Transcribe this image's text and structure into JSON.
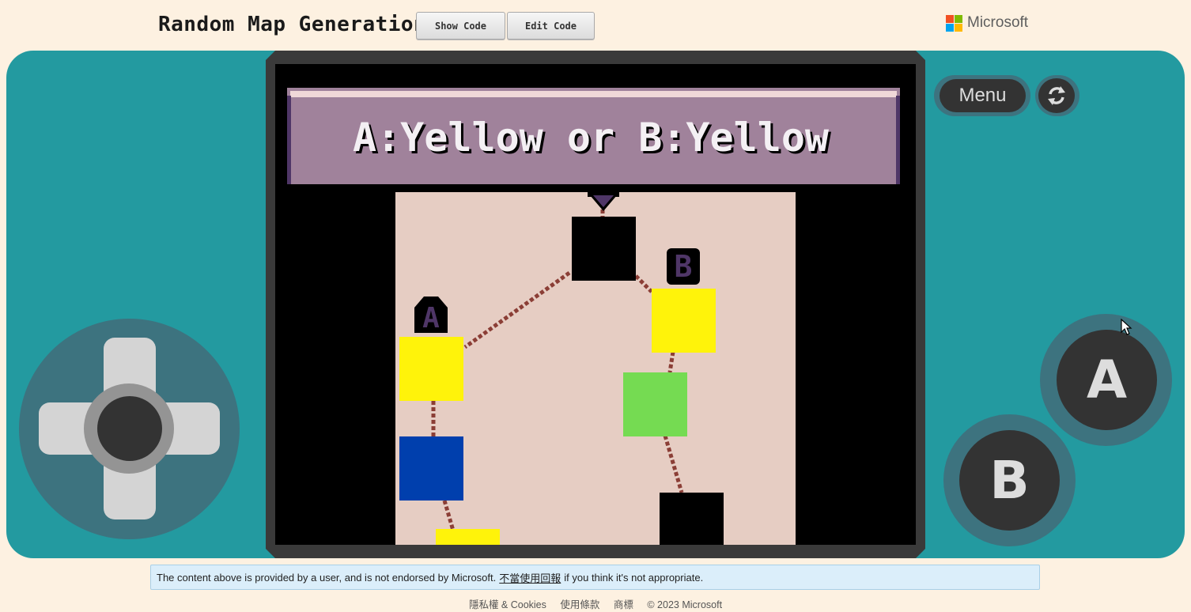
{
  "header": {
    "title": "Random Map Generation",
    "show_code_label": "Show Code",
    "edit_code_label": "Edit Code",
    "brand": "Microsoft"
  },
  "game": {
    "banner_text": "A:Yellow or  B:Yellow",
    "marker_a": "A",
    "marker_b": "B",
    "colors": {
      "banner": "#a0829b",
      "map_bg": "#e6cdc3",
      "yellow": "#fff30a",
      "green": "#75db52",
      "blue": "#003fad",
      "black": "#000000",
      "path": "#8b3e36",
      "marker": "#4f3667"
    }
  },
  "controls": {
    "menu_label": "Menu",
    "a_label": "A",
    "b_label": "B"
  },
  "notice": {
    "prefix": "The content above is provided by a user, and is not endorsed by Microsoft.",
    "link": "不當使用回報",
    "suffix": "if you think it's not appropriate."
  },
  "footer": {
    "privacy": "隱私權 & Cookies",
    "terms": "使用條款",
    "trademarks": "商標",
    "copyright": "© 2023 Microsoft"
  }
}
